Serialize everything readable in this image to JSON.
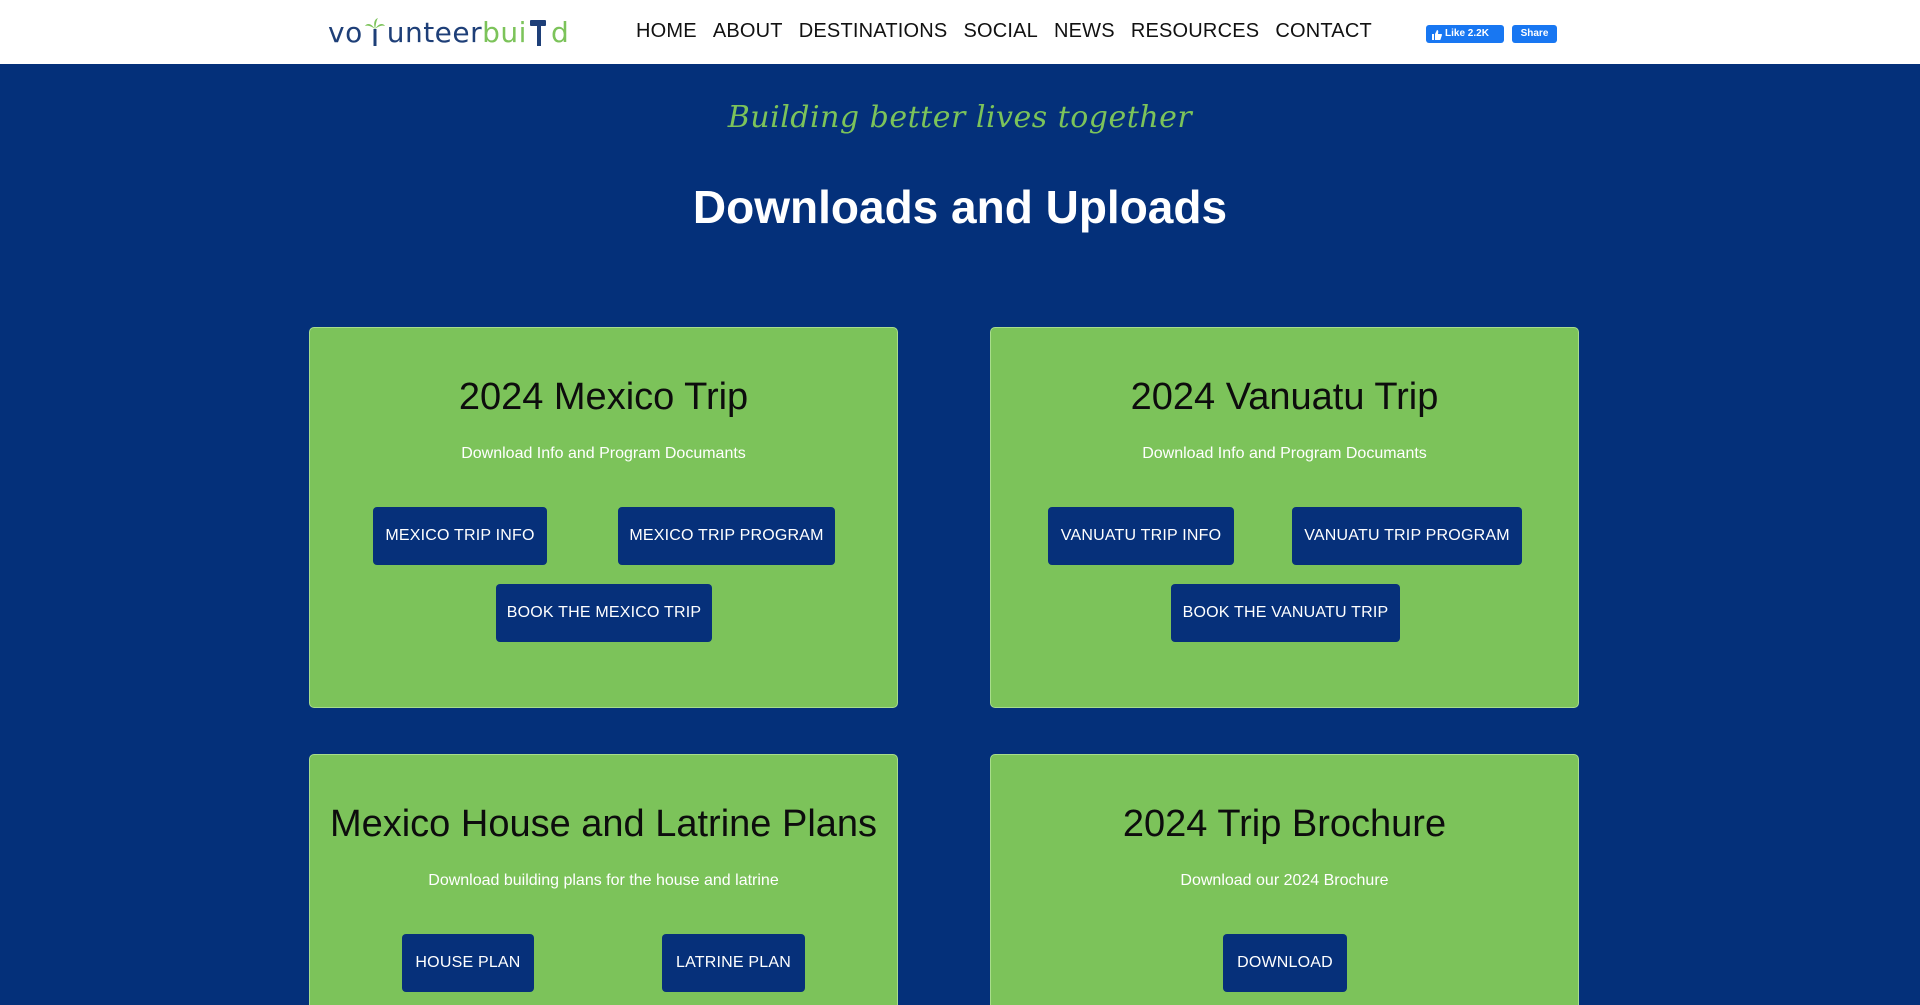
{
  "header": {
    "logo": {
      "part1": "vo",
      "part2": "unteer",
      "part3": "bui",
      "part4": "d"
    },
    "nav": [
      "HOME",
      "ABOUT",
      "DESTINATIONS",
      "SOCIAL",
      "NEWS",
      "RESOURCES",
      "CONTACT"
    ],
    "facebook": {
      "like_label": "Like 2.2K",
      "share_label": "Share"
    }
  },
  "hero": {
    "tagline": "Building better lives together",
    "title": "Downloads and Uploads"
  },
  "cards": {
    "mexico": {
      "title": "2024 Mexico Trip",
      "subtitle": "Download Info and Program Documants",
      "buttons": [
        "MEXICO TRIP INFO",
        "MEXICO TRIP PROGRAM",
        "BOOK THE MEXICO TRIP"
      ]
    },
    "vanuatu": {
      "title": "2024 Vanuatu Trip",
      "subtitle": "Download Info and Program Documants",
      "buttons": [
        "VANUATU TRIP INFO",
        "VANUATU TRIP PROGRAM",
        "BOOK THE VANUATU TRIP"
      ]
    },
    "plans": {
      "title": "Mexico House and Latrine Plans",
      "subtitle": "Download building plans for the house and latrine",
      "buttons": [
        "HOUSE PLAN",
        "LATRINE PLAN"
      ]
    },
    "brochure": {
      "title": "2024 Trip Brochure",
      "subtitle": "Download our 2024 Brochure",
      "buttons": [
        "DOWNLOAD"
      ]
    }
  },
  "colors": {
    "background": "#04307a",
    "card": "#7cc35a",
    "button": "#06307a",
    "accent_green": "#7cc35a",
    "facebook_blue": "#1877f2"
  },
  "icons": [
    "palm-tree-icon",
    "hammer-icon",
    "thumbs-up-icon"
  ]
}
